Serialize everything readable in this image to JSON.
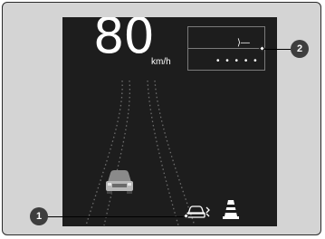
{
  "speed": {
    "value": "80",
    "unit": "km/h"
  },
  "top_right_panel": {
    "indicator": "⟩—",
    "gap_dots": "• • • • •"
  },
  "callouts": {
    "one": "1",
    "two": "2"
  },
  "icons": {
    "lead_vehicle": "car-rear-icon",
    "acc_indicator": "acc-car-icon",
    "road_cone": "cone-icon"
  },
  "colors": {
    "display_bg": "#1d1d1d",
    "frame_bg": "#d4d4d4",
    "text": "#ffffff"
  }
}
